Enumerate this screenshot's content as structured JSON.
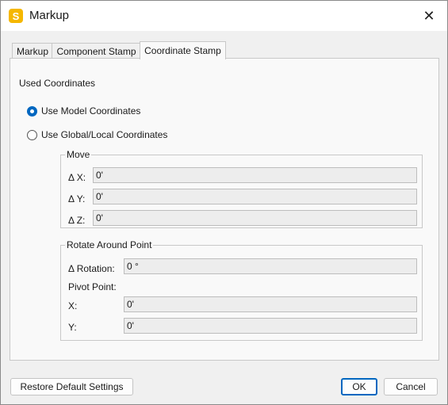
{
  "window": {
    "title": "Markup",
    "app_icon_letter": "S",
    "close_glyph": "✕"
  },
  "tabs": [
    {
      "label": "Markup",
      "active": false
    },
    {
      "label": "Component Stamp",
      "active": false
    },
    {
      "label": "Coordinate Stamp",
      "active": true
    }
  ],
  "used_coordinates": {
    "label": "Used Coordinates",
    "options": [
      {
        "label": "Use Model Coordinates",
        "selected": true
      },
      {
        "label": "Use Global/Local Coordinates",
        "selected": false
      }
    ]
  },
  "move": {
    "title": "Move",
    "fields": [
      {
        "label": "Δ X:",
        "value": "0'"
      },
      {
        "label": "Δ Y:",
        "value": "0'"
      },
      {
        "label": "Δ Z:",
        "value": "0'"
      }
    ]
  },
  "rotate": {
    "title": "Rotate Around Point",
    "rotation_label": "Δ Rotation:",
    "rotation_value": "0 °",
    "pivot_label": "Pivot Point:",
    "x_label": "X:",
    "x_value": "0'",
    "y_label": "Y:",
    "y_value": "0'"
  },
  "buttons": {
    "restore": "Restore Default Settings",
    "ok": "OK",
    "cancel": "Cancel"
  },
  "colors": {
    "accent": "#0067c0",
    "app_icon": "#f5b700"
  }
}
